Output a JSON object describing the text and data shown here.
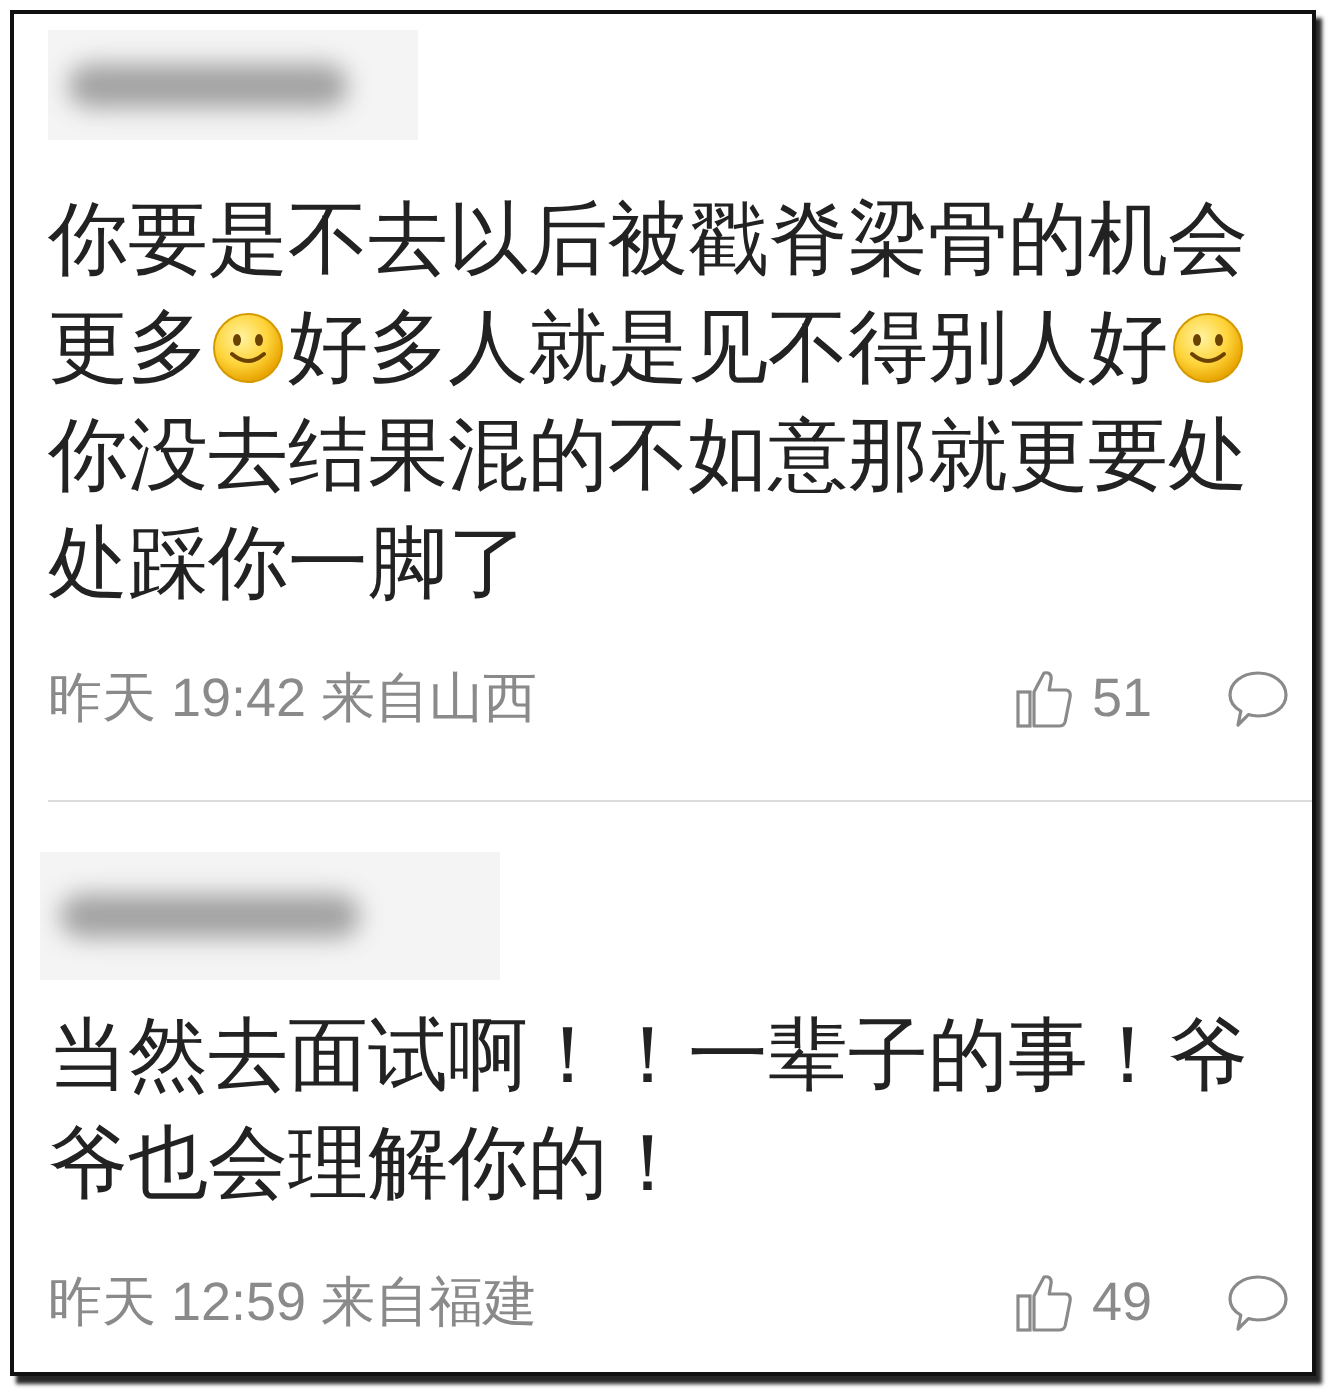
{
  "comments": [
    {
      "body_lines": [
        [
          {
            "kind": "text",
            "text": "你要是不去以后被戳脊梁骨的机会"
          }
        ],
        [
          {
            "kind": "text",
            "text": "更多"
          },
          {
            "kind": "emoji"
          },
          {
            "kind": "text",
            "text": "好多人就是见不得别人好"
          },
          {
            "kind": "emoji"
          }
        ],
        [
          {
            "kind": "text",
            "text": "你没去结果混的不如意那就更要处"
          }
        ],
        [
          {
            "kind": "text",
            "text": "处踩你一脚了"
          }
        ]
      ],
      "meta": "昨天 19:42 来自山西",
      "likes": "51"
    },
    {
      "body_lines": [
        [
          {
            "kind": "text",
            "text": "当然去面试啊！！一辈子的事！爷"
          }
        ],
        [
          {
            "kind": "text",
            "text": "爷也会理解你的！"
          }
        ]
      ],
      "meta": "昨天 12:59 来自福建",
      "likes": "49"
    }
  ]
}
